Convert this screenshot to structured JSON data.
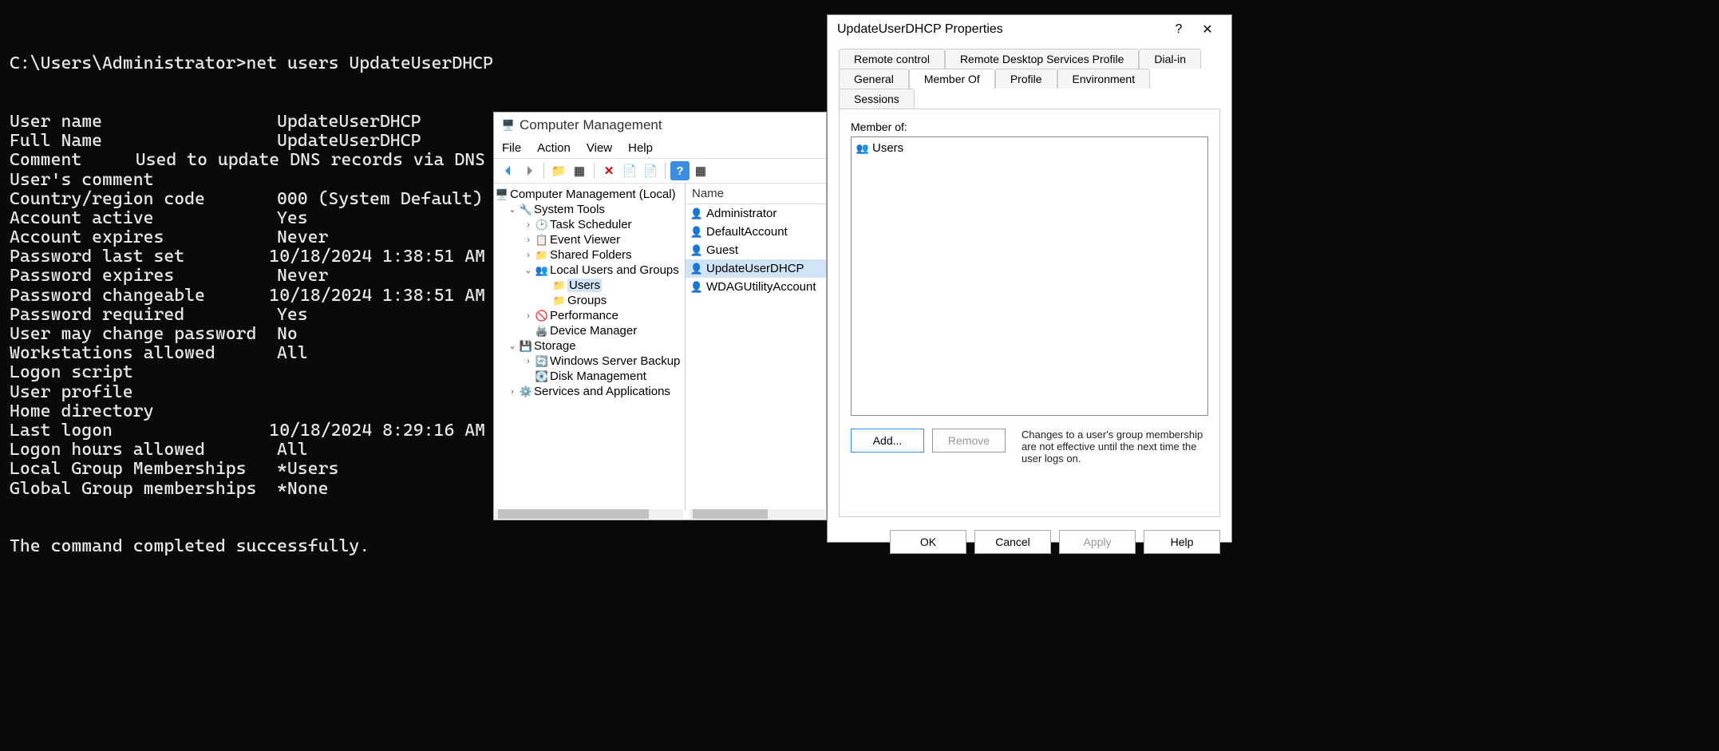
{
  "terminal": {
    "prompt": "C:\\Users\\Administrator>",
    "command": "net users UpdateUserDHCP",
    "rows": [
      {
        "label": "User name",
        "value": "UpdateUserDHCP"
      },
      {
        "label": "Full Name",
        "value": "UpdateUserDHCP"
      },
      {
        "label": "Comment",
        "value": "Used to update DNS records via DNS"
      },
      {
        "label": "User's comment",
        "value": ""
      },
      {
        "label": "Country/region code",
        "value": "000 (System Default)"
      },
      {
        "label": "Account active",
        "value": "Yes"
      },
      {
        "label": "Account expires",
        "value": "Never"
      },
      {
        "label": "",
        "value": ""
      },
      {
        "label": "Password last set",
        "value": "10/18/2024 1:38:51 AM"
      },
      {
        "label": "Password expires",
        "value": "Never"
      },
      {
        "label": "Password changeable",
        "value": "10/18/2024 1:38:51 AM"
      },
      {
        "label": "Password required",
        "value": "Yes"
      },
      {
        "label": "User may change password",
        "value": "No"
      },
      {
        "label": "",
        "value": ""
      },
      {
        "label": "Workstations allowed",
        "value": "All"
      },
      {
        "label": "Logon script",
        "value": ""
      },
      {
        "label": "User profile",
        "value": ""
      },
      {
        "label": "Home directory",
        "value": ""
      },
      {
        "label": "Last logon",
        "value": "10/18/2024 8:29:16 AM"
      },
      {
        "label": "",
        "value": ""
      },
      {
        "label": "Logon hours allowed",
        "value": "All"
      },
      {
        "label": "",
        "value": ""
      },
      {
        "label": "Local Group Memberships",
        "value": "*Users"
      },
      {
        "label": "Global Group memberships",
        "value": "*None"
      }
    ],
    "footer": "The command completed successfully."
  },
  "cm": {
    "title": "Computer Management",
    "menu": [
      "File",
      "Action",
      "View",
      "Help"
    ],
    "tree": {
      "root": "Computer Management (Local)",
      "system_tools": "System Tools",
      "task_scheduler": "Task Scheduler",
      "event_viewer": "Event Viewer",
      "shared_folders": "Shared Folders",
      "local_users": "Local Users and Groups",
      "users": "Users",
      "groups": "Groups",
      "performance": "Performance",
      "device_manager": "Device Manager",
      "storage": "Storage",
      "server_backup": "Windows Server Backup",
      "disk_mgmt": "Disk Management",
      "services": "Services and Applications"
    },
    "list_header": "Name",
    "users": [
      "Administrator",
      "DefaultAccount",
      "Guest",
      "UpdateUserDHCP",
      "WDAGUtilityAccount"
    ]
  },
  "prop": {
    "title": "UpdateUserDHCP Properties",
    "tabs_row1": [
      "Remote control",
      "Remote Desktop Services Profile",
      "Dial-in"
    ],
    "tabs_row2": [
      "General",
      "Member Of",
      "Profile",
      "Environment",
      "Sessions"
    ],
    "active_tab": "Member Of",
    "member_of_label": "Member of:",
    "members": [
      "Users"
    ],
    "add_btn": "Add...",
    "remove_btn": "Remove",
    "note": "Changes to a user's group membership are not effective until the next time the user logs on.",
    "ok": "OK",
    "cancel": "Cancel",
    "apply": "Apply",
    "help": "Help"
  }
}
